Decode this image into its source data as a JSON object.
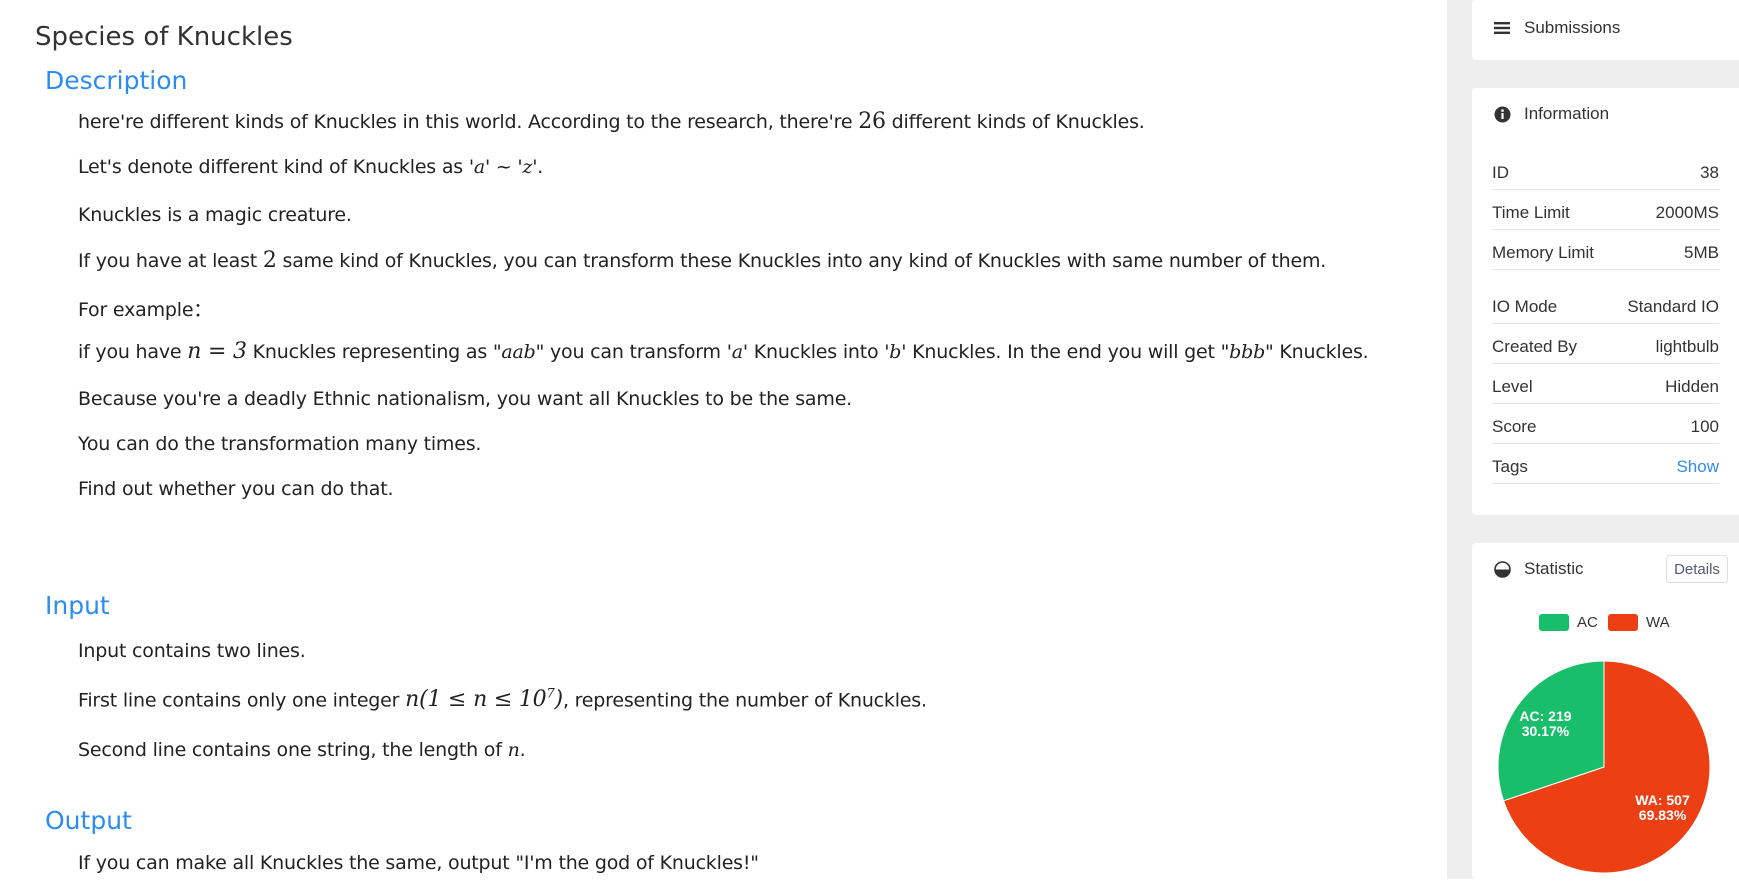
{
  "problem": {
    "title": "Species of Knuckles",
    "sections": {
      "description": "Description",
      "input": "Input",
      "output": "Output"
    },
    "description": {
      "p1_a": "here're different kinds of Knuckles in this world. According to the research, there're ",
      "p1_num": "26",
      "p1_b": " different kinds of Knuckles.",
      "p2_a": "Let's denote different kind of Knuckles as '",
      "p2_m1": "a",
      "p2_b": "' ~ '",
      "p2_m2": "z",
      "p2_c": "'.",
      "p3": "Knuckles is a magic creature.",
      "p4_a": "If you have at least ",
      "p4_num": "2",
      "p4_b": " same kind of Knuckles, you can transform these Knuckles into any kind of Knuckles with same number of them.",
      "p5": "For example：",
      "p6_a": "if you have ",
      "p6_m1": "n = 3",
      "p6_b": " Knuckles representing as \"",
      "p6_m2": "aab",
      "p6_c": "\" you can transform '",
      "p6_m3": "a",
      "p6_d": "' Knuckles into '",
      "p6_m4": "b",
      "p6_e": "' Knuckles. In the end you will get \"",
      "p6_m5": "bbb",
      "p6_f": "\" Knuckles.",
      "p7": "Because you're a deadly Ethnic nationalism, you want all Knuckles to be the same.",
      "p8": "You can do the transformation many times.",
      "p9": "Find out whether you can do that."
    },
    "input": {
      "p1": "Input contains two lines.",
      "p2_a": "First line contains only one integer ",
      "p2_m": "n(1 ≤ n ≤ 10",
      "p2_sup": "7",
      "p2_m_end": ")",
      "p2_b": ", representing the number of Knuckles.",
      "p3_a": "Second line contains one string, the length of ",
      "p3_m": "n",
      "p3_b": "."
    },
    "output": {
      "p1": "If you can make all Knuckles the same, output \"I'm the god of Knuckles!\""
    }
  },
  "sidebar": {
    "submissions": {
      "label": "Submissions",
      "icon": "list-icon"
    },
    "information": {
      "label": "Information",
      "icon": "info-icon",
      "rows": [
        {
          "key": "ID",
          "value": "38"
        },
        {
          "key": "Time Limit",
          "value": "2000MS"
        },
        {
          "key": "Memory Limit",
          "value": "5MB"
        },
        {
          "key": "IO Mode",
          "value": "Standard IO"
        },
        {
          "key": "Created By",
          "value": "lightbulb"
        },
        {
          "key": "Level",
          "value": "Hidden"
        },
        {
          "key": "Score",
          "value": "100"
        },
        {
          "key": "Tags",
          "value": "Show"
        }
      ]
    },
    "statistic": {
      "label": "Statistic",
      "icon": "pie-chart-icon",
      "details_button": "Details"
    }
  },
  "chart_data": {
    "type": "pie",
    "legend": [
      "AC",
      "WA"
    ],
    "legend_position": "top",
    "slices": [
      {
        "name": "AC",
        "value": 219,
        "label": "AC: 219",
        "percent": "30.17%",
        "color": "#19be6b"
      },
      {
        "name": "WA",
        "value": 507,
        "label": "WA: 507",
        "percent": "69.83%",
        "color": "#ed3f14"
      }
    ]
  }
}
